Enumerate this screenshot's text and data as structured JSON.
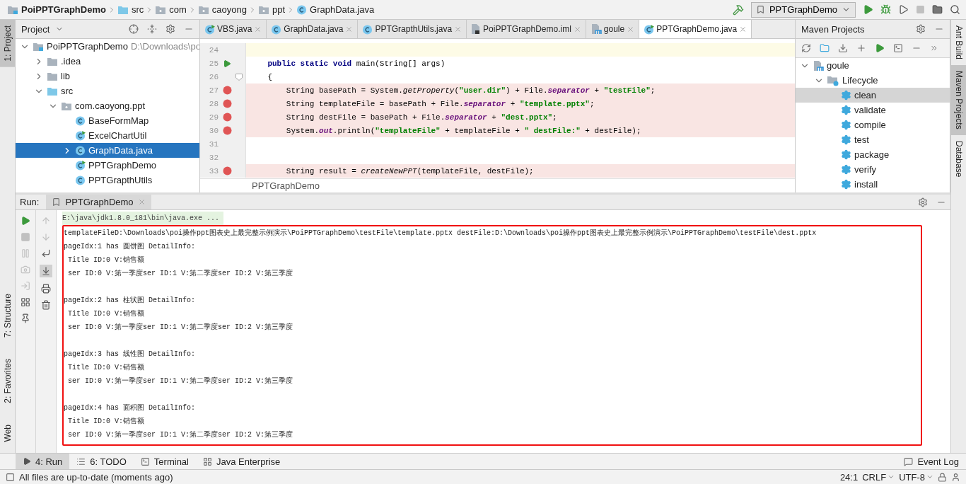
{
  "navbar": {
    "breadcrumbs": [
      {
        "kind": "module",
        "label": "PoiPPTGraphDemo"
      },
      {
        "kind": "source-folder",
        "label": "src"
      },
      {
        "kind": "package",
        "label": "com"
      },
      {
        "kind": "package",
        "label": "caoyong"
      },
      {
        "kind": "package",
        "label": "ppt"
      },
      {
        "kind": "class",
        "label": "GraphData.java"
      }
    ],
    "run_config": "PPTGraphDemo"
  },
  "left_stripe": {
    "top": [
      {
        "label": "1: Project",
        "selected": true
      }
    ],
    "bottom": [
      {
        "label": "7: Structure",
        "selected": false
      },
      {
        "label": "2: Favorites",
        "selected": false
      },
      {
        "label": "Web",
        "selected": false
      }
    ]
  },
  "right_stripe": [
    {
      "label": "Ant Build",
      "selected": false
    },
    {
      "label": "Maven Projects",
      "selected": true
    },
    {
      "label": "Database",
      "selected": false
    }
  ],
  "project": {
    "title": "Project",
    "tree": [
      {
        "kind": "module",
        "label": "PoiPPTGraphDemo",
        "path": "D:\\Downloads\\po",
        "expanded": true,
        "selected": false,
        "children": [
          {
            "kind": "folder",
            "label": ".idea",
            "expanded": false,
            "selected": false
          },
          {
            "kind": "folder",
            "label": "lib",
            "expanded": false,
            "selected": false
          },
          {
            "kind": "source-folder",
            "label": "src",
            "expanded": true,
            "selected": false,
            "children": [
              {
                "kind": "package",
                "label": "com.caoyong.ppt",
                "expanded": true,
                "selected": false,
                "children": [
                  {
                    "kind": "class",
                    "label": "BaseFormMap",
                    "selected": false
                  },
                  {
                    "kind": "class-run",
                    "label": "ExcelChartUtil",
                    "selected": false
                  },
                  {
                    "kind": "class",
                    "label": "GraphData.java",
                    "expanded": false,
                    "selected": true
                  },
                  {
                    "kind": "class-run",
                    "label": "PPTGraphDemo",
                    "selected": false
                  },
                  {
                    "kind": "class",
                    "label": "PPTGrapthUtils",
                    "selected": false
                  }
                ]
              }
            ]
          }
        ]
      }
    ]
  },
  "editor": {
    "tabs": [
      {
        "kind": "class-run",
        "label": "VBS.java",
        "selected": false
      },
      {
        "kind": "class",
        "label": "GraphData.java",
        "selected": false
      },
      {
        "kind": "class",
        "label": "PPTGrapthUtils.java",
        "selected": false
      },
      {
        "kind": "iml",
        "label": "PoiPPTGraphDemo.iml",
        "selected": false
      },
      {
        "kind": "maven",
        "label": "goule",
        "selected": false
      },
      {
        "kind": "class-run",
        "label": "PPTGraphDemo.java",
        "selected": true
      }
    ],
    "lines": [
      {
        "number": "24",
        "current": true,
        "breakpoint": false,
        "runnable": false,
        "fold": false
      },
      {
        "number": "25",
        "current": false,
        "breakpoint": false,
        "runnable": true,
        "fold": false,
        "tokens": [
          {
            "kind": "keyword",
            "text": "    public static void "
          },
          {
            "kind": "plain",
            "text": "main(String[] args)"
          }
        ]
      },
      {
        "number": "26",
        "current": false,
        "breakpoint": false,
        "runnable": false,
        "fold": true,
        "tokens": [
          {
            "kind": "plain",
            "text": "    {"
          }
        ]
      },
      {
        "number": "27",
        "current": false,
        "breakpoint": true,
        "runnable": false,
        "fold": false,
        "tokens": [
          {
            "kind": "plain",
            "text": "        String basePath = System."
          },
          {
            "kind": "method",
            "text": "getProperty"
          },
          {
            "kind": "plain",
            "text": "("
          },
          {
            "kind": "string",
            "text": "\"user.dir\""
          },
          {
            "kind": "plain",
            "text": ") + File."
          },
          {
            "kind": "field",
            "text": "separator"
          },
          {
            "kind": "plain",
            "text": " + "
          },
          {
            "kind": "string",
            "text": "\"testFile\""
          },
          {
            "kind": "plain",
            "text": ";"
          }
        ]
      },
      {
        "number": "28",
        "current": false,
        "breakpoint": true,
        "runnable": false,
        "fold": false,
        "tokens": [
          {
            "kind": "plain",
            "text": "        String templateFile = basePath + File."
          },
          {
            "kind": "field",
            "text": "separator"
          },
          {
            "kind": "plain",
            "text": " + "
          },
          {
            "kind": "string",
            "text": "\"template.pptx\""
          },
          {
            "kind": "plain",
            "text": ";"
          }
        ]
      },
      {
        "number": "29",
        "current": false,
        "breakpoint": true,
        "runnable": false,
        "fold": false,
        "tokens": [
          {
            "kind": "plain",
            "text": "        String destFile = basePath + File."
          },
          {
            "kind": "field",
            "text": "separator"
          },
          {
            "kind": "plain",
            "text": " + "
          },
          {
            "kind": "string",
            "text": "\"dest.pptx\""
          },
          {
            "kind": "plain",
            "text": ";"
          }
        ]
      },
      {
        "number": "30",
        "current": false,
        "breakpoint": true,
        "runnable": false,
        "fold": false,
        "tokens": [
          {
            "kind": "plain",
            "text": "        System."
          },
          {
            "kind": "field",
            "text": "out"
          },
          {
            "kind": "plain",
            "text": ".println("
          },
          {
            "kind": "string",
            "text": "\"templateFile\""
          },
          {
            "kind": "plain",
            "text": " + templateFile + "
          },
          {
            "kind": "string",
            "text": "\" destFile:\""
          },
          {
            "kind": "plain",
            "text": " + destFile);"
          }
        ]
      },
      {
        "number": "31",
        "current": false,
        "breakpoint": false,
        "runnable": false,
        "fold": false
      },
      {
        "number": "32",
        "current": false,
        "breakpoint": false,
        "runnable": false,
        "fold": false
      },
      {
        "number": "33",
        "current": false,
        "breakpoint": true,
        "runnable": false,
        "fold": false,
        "tokens": [
          {
            "kind": "plain",
            "text": "        String result = "
          },
          {
            "kind": "method",
            "text": "createNewPPT"
          },
          {
            "kind": "plain",
            "text": "(templateFile, destFile);"
          }
        ]
      }
    ],
    "breadcrumb": "PPTGraphDemo"
  },
  "maven": {
    "title": "Maven Projects",
    "tree": [
      {
        "kind": "maven",
        "label": "goule",
        "expanded": true,
        "selected": false,
        "children": [
          {
            "kind": "lifecycle",
            "label": "Lifecycle",
            "expanded": true,
            "selected": false,
            "children": [
              {
                "kind": "goal",
                "label": "clean",
                "selected": true
              },
              {
                "kind": "goal",
                "label": "validate",
                "selected": false
              },
              {
                "kind": "goal",
                "label": "compile",
                "selected": false
              },
              {
                "kind": "goal",
                "label": "test",
                "selected": false
              },
              {
                "kind": "goal",
                "label": "package",
                "selected": false
              },
              {
                "kind": "goal",
                "label": "verify",
                "selected": false
              },
              {
                "kind": "goal",
                "label": "install",
                "selected": false
              }
            ]
          }
        ]
      }
    ]
  },
  "run": {
    "label": "Run:",
    "tab": "PPTGraphDemo",
    "command": "E:\\java\\jdk1.8.0_181\\bin\\java.exe ...",
    "output": [
      [
        "templateFileD:\\Downloads\\poi操作ppt图表史上最完整示例演示\\PoiPPTGraphDemo\\testFile\\template.pptx destFile:D:\\Downloads\\poi操作ppt图表史上最完整示例演示\\PoiPPTGraphDemo\\testFile\\dest.pptx",
        "pageIdx:1 has 圆饼图 DetailInfo:",
        " Title ID:0 V:销售额",
        " ser ID:0 V:第一季度ser ID:1 V:第二季度ser ID:2 V:第三季度"
      ],
      [
        "pageIdx:2 has 柱状图 DetailInfo:",
        " Title ID:0 V:销售额",
        " ser ID:0 V:第一季度ser ID:1 V:第二季度ser ID:2 V:第三季度"
      ],
      [
        "pageIdx:3 has 线性图 DetailInfo:",
        " Title ID:0 V:销售额",
        " ser ID:0 V:第一季度ser ID:1 V:第二季度ser ID:2 V:第三季度"
      ],
      [
        "pageIdx:4 has 面积图 DetailInfo:",
        " Title ID:0 V:销售额",
        " ser ID:0 V:第一季度ser ID:1 V:第二季度ser ID:2 V:第三季度"
      ]
    ]
  },
  "tool_tabs": [
    {
      "kind": "run",
      "label": "4: Run",
      "selected": true
    },
    {
      "kind": "todo",
      "label": "6: TODO",
      "selected": false
    },
    {
      "kind": "terminal",
      "label": "Terminal",
      "selected": false
    },
    {
      "kind": "enterprise",
      "label": "Java Enterprise",
      "selected": false
    }
  ],
  "event_log": "Event Log",
  "status_bar": {
    "message": "All files are up-to-date (moments ago)",
    "position": "24:1",
    "line_separator": "CRLF",
    "encoding": "UTF-8"
  }
}
